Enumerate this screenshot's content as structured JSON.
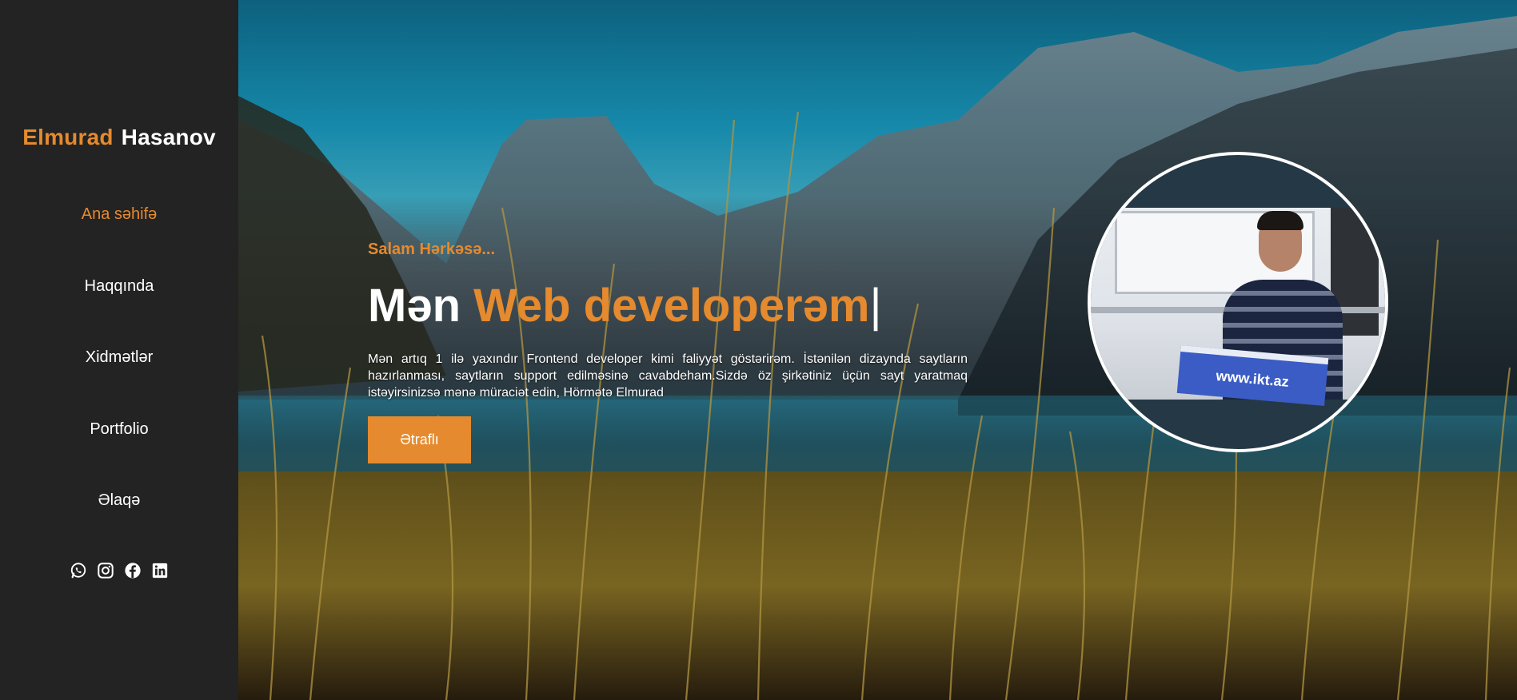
{
  "brand": {
    "first_name": "Elmurad",
    "last_name": "Hasanov"
  },
  "nav": {
    "items": [
      {
        "label": "Ana səhifə",
        "active": true
      },
      {
        "label": "Haqqında",
        "active": false
      },
      {
        "label": "Xidmətlər",
        "active": false
      },
      {
        "label": "Portfolio",
        "active": false
      },
      {
        "label": "Əlaqə",
        "active": false
      }
    ]
  },
  "socials": [
    "whatsapp-icon",
    "instagram-icon",
    "facebook-icon",
    "linkedin-icon"
  ],
  "hero": {
    "greeting": "Salam Hərkəsə...",
    "headline_prefix": "Mən",
    "headline_accent": "Web developerəm",
    "cursor": "|",
    "intro": "Mən artıq 1 ilə yaxındır Frontend developer kimi faliyyət göstərirəm. İstənilən dizaynda saytların hazırlanması, saytların support edilməsinə cavabdeham.Sizdə öz şirkətiniz üçün sayt yaratmaq istəyirsinizsə mənə müraciət edin, Hörmətə Elmurad",
    "button_label": "Ətraflı",
    "photo_sign_text": "www.ikt.az"
  },
  "colors": {
    "accent": "#e58a2e",
    "sidebar": "#232323",
    "text": "#ffffff"
  }
}
